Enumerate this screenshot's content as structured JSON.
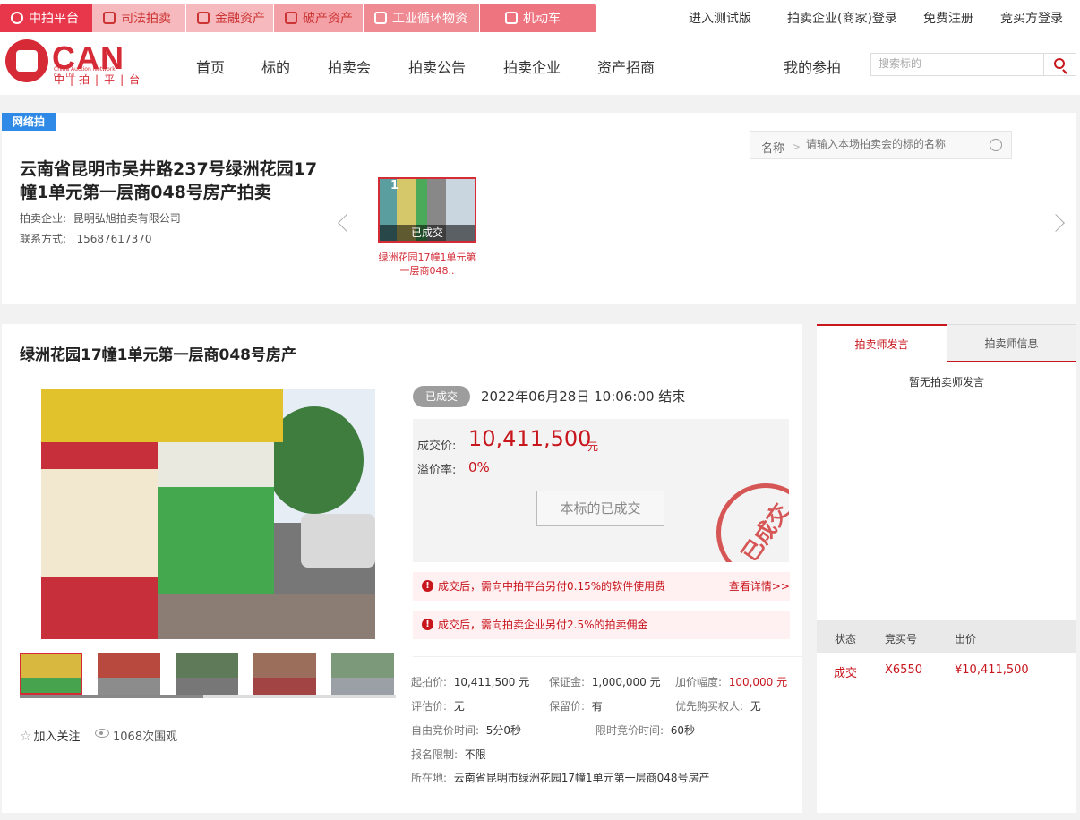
{
  "platform_tabs": [
    {
      "label": "中拍平台",
      "icon": "platform-logo-icon"
    },
    {
      "label": "司法拍卖",
      "icon": "gavel-icon"
    },
    {
      "label": "金融资产",
      "icon": "bank-icon"
    },
    {
      "label": "破产资产",
      "icon": "bankruptcy-icon"
    },
    {
      "label": "工业循环物资",
      "icon": "recycle-icon"
    },
    {
      "label": "机动车",
      "icon": "car-icon"
    }
  ],
  "top_links": [
    "进入测试版",
    "拍卖企业(商家)登录",
    "免费注册",
    "竞买方登录"
  ],
  "logo": {
    "text": "CAN",
    "sub": "China Auction Network Co., Ltd.",
    "cn": "中|拍|平|台"
  },
  "nav": [
    "首页",
    "标的",
    "拍卖会",
    "拍卖公告",
    "拍卖企业",
    "资产招商"
  ],
  "my_bids": "我的参拍",
  "search": {
    "placeholder": "搜索标的"
  },
  "session": {
    "badge": "网络拍",
    "title": "云南省昆明市吴井路237号绿洲花园17幢1单元第一层商048号房产拍卖",
    "company_label": "拍卖企业:",
    "company": "昆明弘旭拍卖有限公司",
    "contact_label": "联系方式:",
    "contact": "15687617370",
    "lot_search_label": "名称",
    "lot_search_placeholder": "请输入本场拍卖会的标的名称",
    "lot_thumb": {
      "number": "1",
      "status": "已成交",
      "caption": "绿洲花园17幢1单元第一层商048.."
    }
  },
  "lot": {
    "title": "绿洲花园17幢1单元第一层商048号房产",
    "status": "已成交",
    "end_time": "2022年06月28日  10:06:00 结束",
    "deal_price_label": "成交价:",
    "deal_price": "10,411,500",
    "deal_unit": "元",
    "premium_label": "溢价率:",
    "premium": "0%",
    "done_button": "本标的已成交",
    "stamp": "已成交",
    "notice1": "成交后，需向中拍平台另付0.15%的软件使用费",
    "notice1_link": "查看详情>>",
    "notice2": "成交后，需向拍卖企业另付2.5%的拍卖佣金",
    "follow": "加入关注",
    "views": "1068次围观",
    "info": {
      "start_price_k": "起拍价:",
      "start_price_v": "10,411,500 元",
      "deposit_k": "保证金:",
      "deposit_v": "1,000,000 元",
      "increment_k": "加价幅度:",
      "increment_v": "100,000 元",
      "appraisal_k": "评估价:",
      "appraisal_v": "无",
      "reserve_k": "保留价:",
      "reserve_v": "有",
      "priority_k": "优先购买权人:",
      "priority_v": "无",
      "free_bid_k": "自由竞价时间:",
      "free_bid_v": "5分0秒",
      "limit_bid_k": "限时竞价时间:",
      "limit_bid_v": "60秒",
      "signup_k": "报名限制:",
      "signup_v": "不限",
      "location_k": "所在地:",
      "location_v": "云南省昆明市绿洲花园17幢1单元第一层商048号房产"
    }
  },
  "sidebar": {
    "tab_speech": "拍卖师发言",
    "tab_info": "拍卖师信息",
    "no_speech": "暂无拍卖师发言",
    "bid_headers": [
      "状态",
      "竞买号",
      "出价"
    ],
    "bids": [
      {
        "status": "成交",
        "number": "X6550",
        "price": "¥10,411,500"
      }
    ]
  },
  "colors": {
    "accent": "#c8161d",
    "badge": "#2e8ae6"
  }
}
